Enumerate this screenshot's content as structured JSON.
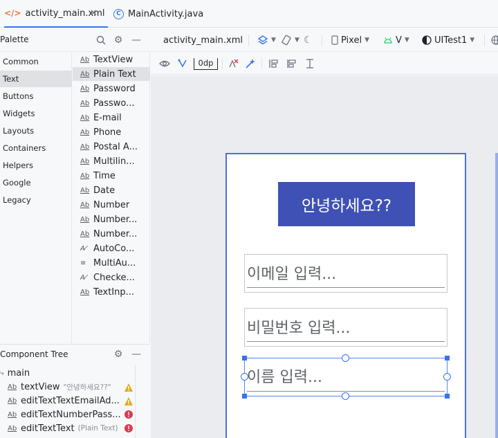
{
  "tabs": [
    {
      "label": "activity_main.xml",
      "icon": "xml-file-icon",
      "active": true
    },
    {
      "label": "MainActivity.java",
      "icon": "java-class-icon",
      "active": false
    }
  ],
  "palette": {
    "title": "Palette",
    "categories": [
      "Common",
      "Text",
      "Buttons",
      "Widgets",
      "Layouts",
      "Containers",
      "Helpers",
      "Google",
      "Legacy"
    ],
    "selected_category": "Text",
    "widgets": [
      "TextView",
      "Plain Text",
      "Password",
      "Passwo...",
      "E-mail",
      "Phone",
      "Postal A...",
      "Multilin...",
      "Time",
      "Date",
      "Number",
      "Number...",
      "Number...",
      "AutoCo...",
      "MultiAu...",
      "Checke...",
      "TextInp..."
    ],
    "selected_widget": "Plain Text"
  },
  "component_tree": {
    "title": "Component Tree",
    "root": "main",
    "nodes": [
      {
        "name": "textView",
        "hint": "\"안녕하세요??\"",
        "status": "warning"
      },
      {
        "name": "editTextTextEmailAd...",
        "hint": "",
        "status": "warning"
      },
      {
        "name": "editTextNumberPass...",
        "hint": "",
        "status": "error"
      },
      {
        "name": "editTextText",
        "hint": "(Plain Text)",
        "status": "error"
      }
    ]
  },
  "toolbar": {
    "file": "activity_main.xml",
    "device": "Pixel",
    "api": "V",
    "theme": "UITest1",
    "margin": "0dp"
  },
  "preview": {
    "title_text": "안녕하세요??",
    "email_hint": "이메일 입력...",
    "password_hint": "비밀번호 입력...",
    "name_hint": "이름 입력..."
  },
  "colors": {
    "accent": "#3574f0",
    "title_bg": "#3f51b5",
    "warning": "#e6a817",
    "error": "#db3b4b"
  }
}
